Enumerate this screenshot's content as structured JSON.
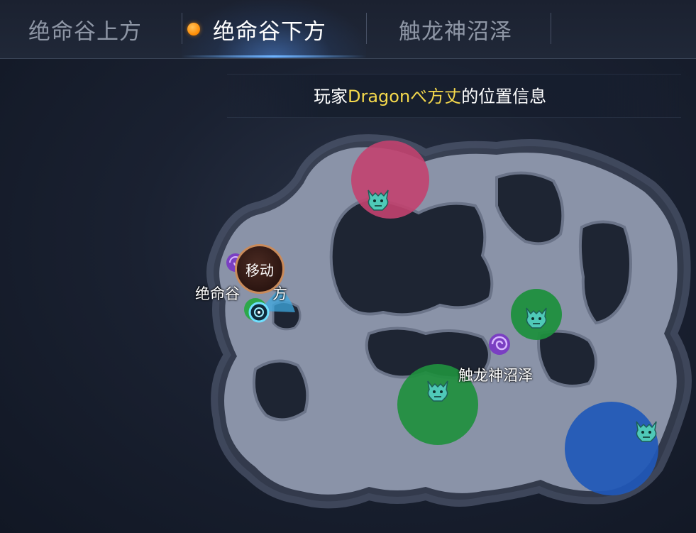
{
  "tabs": [
    {
      "label": "绝命谷上方",
      "active": false
    },
    {
      "label": "绝命谷下方",
      "active": true
    },
    {
      "label": "触龙神沼泽",
      "active": false
    }
  ],
  "info": {
    "prefix": "玩家",
    "player_name": "Dragonべ方丈",
    "suffix": "的位置信息"
  },
  "map": {
    "labels": {
      "valley": "绝命谷",
      "valley_suffix": "方",
      "swamp": "触龙神沼泽"
    },
    "move_button": "移动",
    "zones": [
      {
        "name": "dragon-zone-pink",
        "color": "#c2426f",
        "icon": "dragon-head-icon"
      },
      {
        "name": "dragon-zone-green-small",
        "color": "#1f8f3e",
        "icon": "dragon-head-icon"
      },
      {
        "name": "dragon-zone-green-large",
        "color": "#1f8f3e",
        "icon": "dragon-head-icon"
      },
      {
        "name": "dragon-zone-blue",
        "color": "#1f58b8",
        "icon": "dragon-head-icon"
      }
    ],
    "colors": {
      "highlight": "#f5d94c",
      "active_dot": "#ff8a00",
      "terrain": "#8a93a8",
      "portal": "#9b5de0"
    }
  }
}
